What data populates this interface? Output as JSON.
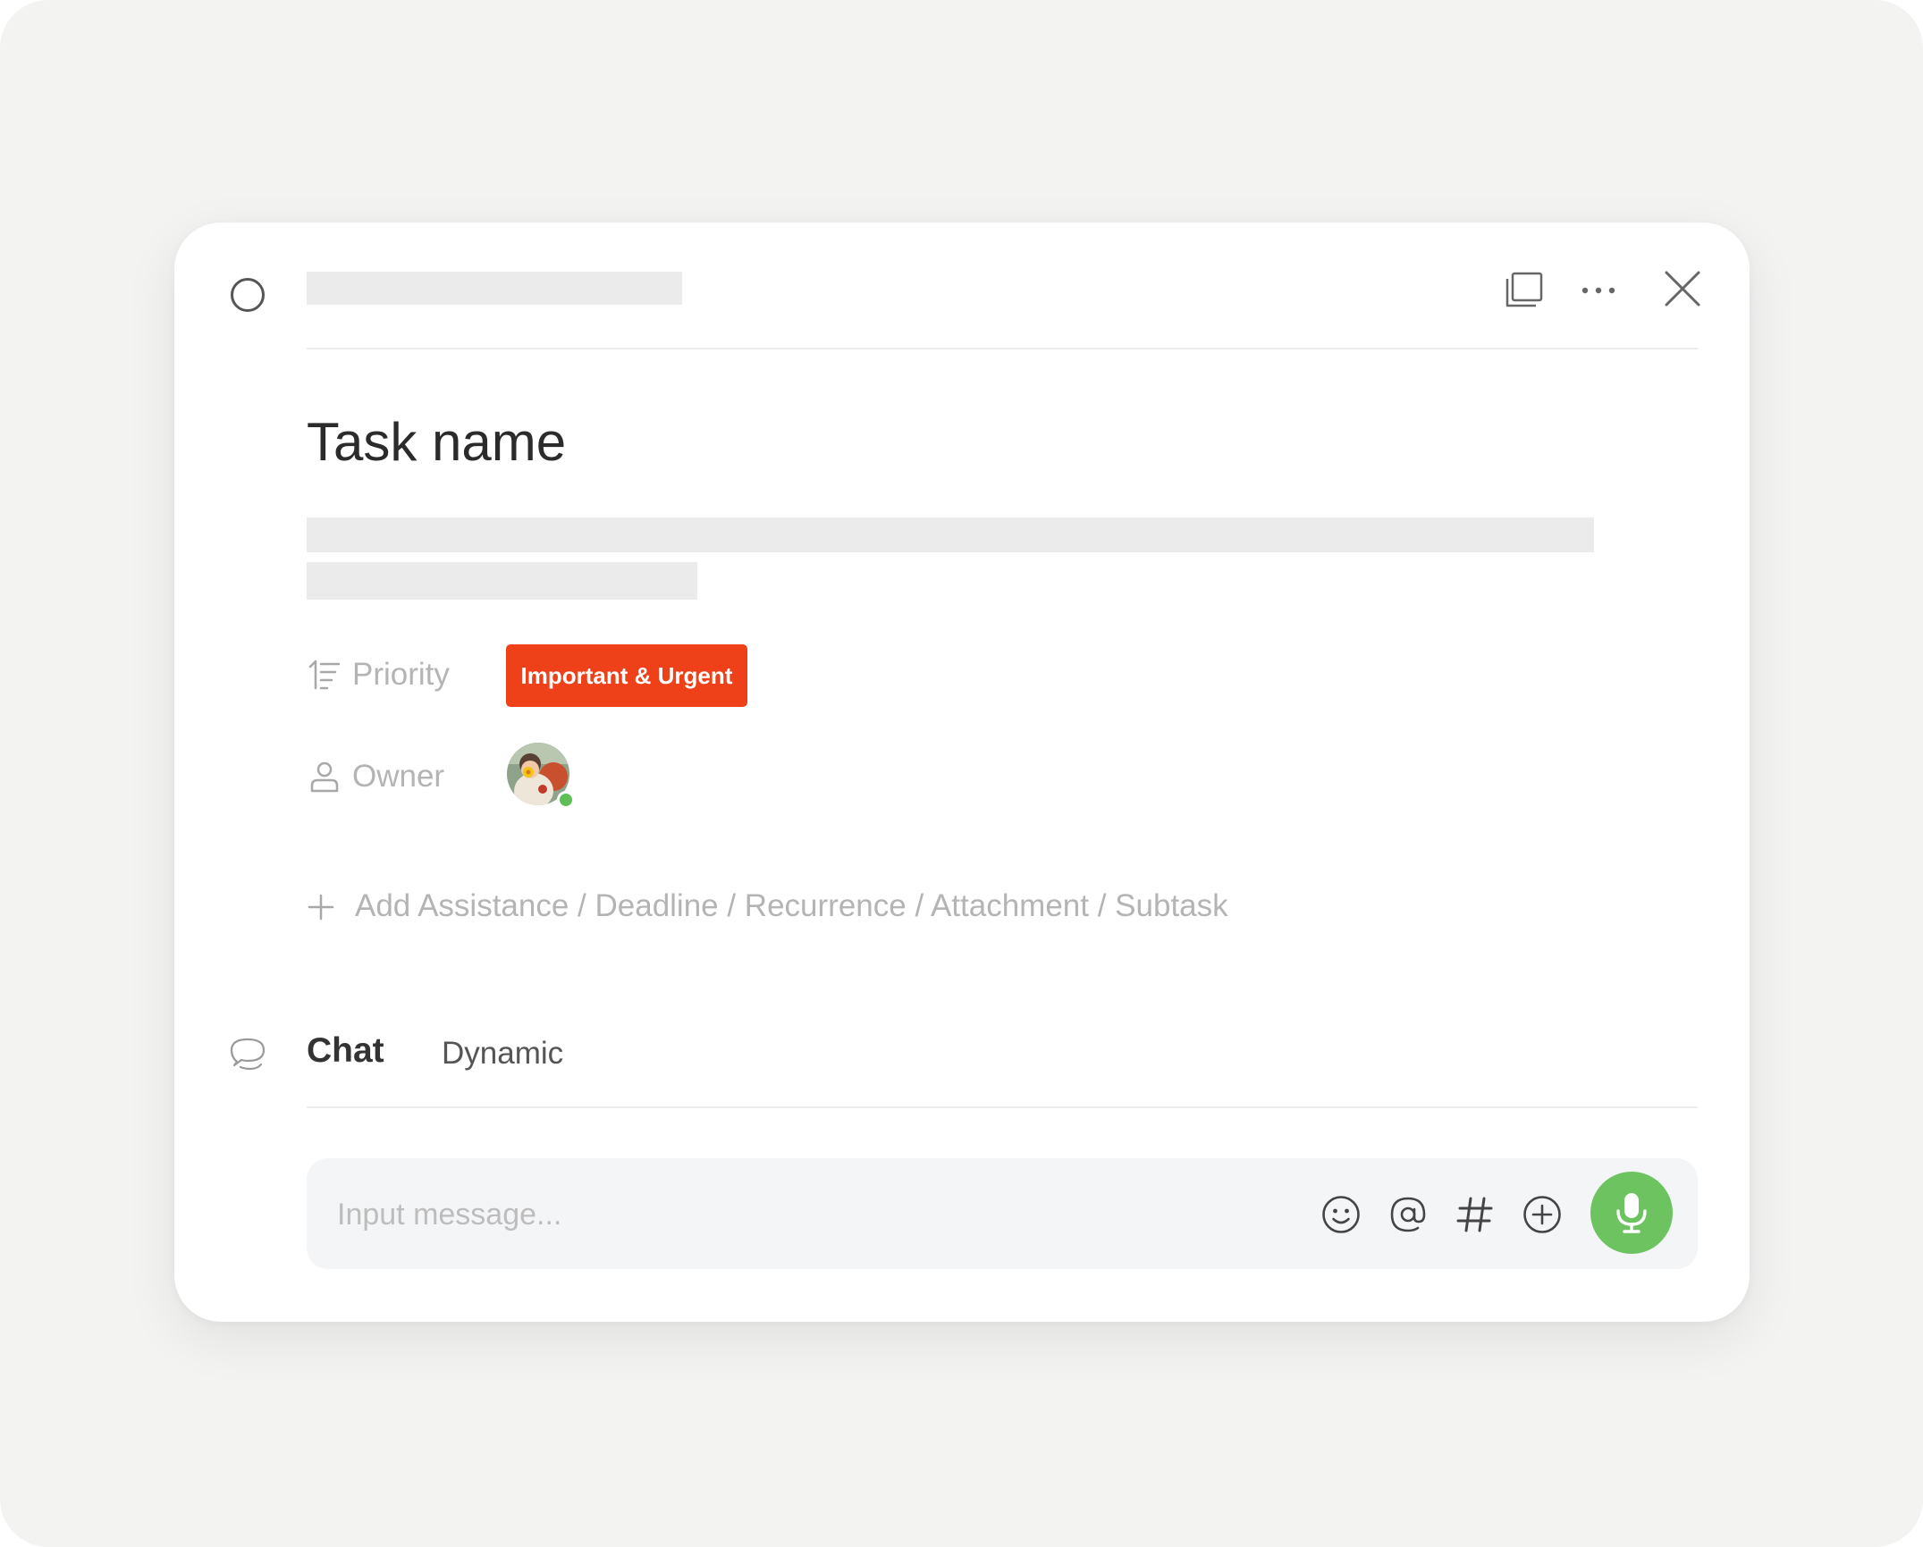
{
  "task": {
    "title": "Task name"
  },
  "properties": {
    "priority": {
      "label": "Priority",
      "value": "Important & Urgent",
      "badge_color": "#ee4019"
    },
    "owner": {
      "label": "Owner",
      "status_color": "#5dbf55"
    }
  },
  "add_fields": {
    "label": "Add Assistance / Deadline / Recurrence / Attachment / Subtask"
  },
  "tabs": [
    {
      "label": "Chat",
      "active": true
    },
    {
      "label": "Dynamic",
      "active": false
    }
  ],
  "composer": {
    "placeholder": "Input message...",
    "send_button_color": "#6cc35f"
  },
  "icons": {
    "header": [
      "complete-circle-icon",
      "window-icon",
      "more-icon",
      "close-icon"
    ],
    "rows": [
      "priority-icon",
      "owner-icon",
      "plus-icon",
      "chat-bubble-icon"
    ],
    "composer": [
      "emoji-icon",
      "mention-icon",
      "hashtag-icon",
      "add-circle-icon",
      "microphone-icon"
    ]
  }
}
